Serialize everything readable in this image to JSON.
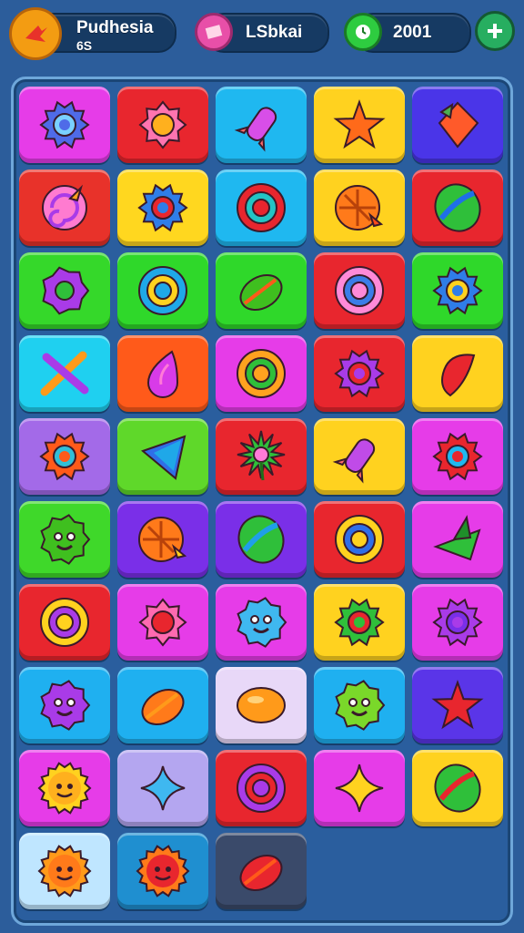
{
  "hud": {
    "player": {
      "name": "Pudhesia",
      "sub": "6S",
      "badge_color": "#f39c12"
    },
    "currency": {
      "label": "LSbkai",
      "icon_color": "#e84fa8"
    },
    "score": {
      "value": "2001",
      "icon_color": "#2ecc40"
    },
    "add_button": {
      "icon": "plus-icon",
      "color": "#27ae60"
    }
  },
  "board": {
    "rows": [
      [
        {
          "bg": "#e63ce8",
          "icon": "gear",
          "c1": "#4f6be8",
          "c2": "#7ad0ff"
        },
        {
          "bg": "#e8262e",
          "icon": "flower",
          "c1": "#ff74b0",
          "c2": "#ffb01e"
        },
        {
          "bg": "#1fb8f0",
          "icon": "rocket",
          "c1": "#d84ee8",
          "c2": "#ff6b6b"
        },
        {
          "bg": "#ffd21f",
          "icon": "star",
          "c1": "#ff6a1a",
          "c2": "#2e7d32"
        },
        {
          "bg": "#4a35e8",
          "icon": "kite",
          "c1": "#ff5a2a",
          "c2": "#4caf50"
        }
      ],
      [
        {
          "bg": "#e8322a",
          "icon": "swirl",
          "c1": "#ff7bd0",
          "c2": "#ffa21f"
        },
        {
          "bg": "#ffd71f",
          "icon": "gear",
          "c1": "#2f7de8",
          "c2": "#e8262e"
        },
        {
          "bg": "#1fb8f0",
          "icon": "ring",
          "c1": "#e8262e",
          "c2": "#23c4c4"
        },
        {
          "bg": "#ffd21f",
          "icon": "shell",
          "c1": "#ff7a1a",
          "c2": "#ff4a1a"
        },
        {
          "bg": "#e8262e",
          "icon": "ball",
          "c1": "#2fbf3a",
          "c2": "#1f6fe8"
        }
      ],
      [
        {
          "bg": "#35d82a",
          "icon": "blob",
          "c1": "#a93be8",
          "c2": "#2fbf3a"
        },
        {
          "bg": "#2fd82a",
          "icon": "ring",
          "c1": "#1fa8e8",
          "c2": "#ffd21f"
        },
        {
          "bg": "#2fd82a",
          "icon": "leaf",
          "c1": "#3fbf1f",
          "c2": "#ff5a1a"
        },
        {
          "bg": "#e8262e",
          "icon": "ring",
          "c1": "#ff8ad8",
          "c2": "#3a7de8"
        },
        {
          "bg": "#2fd82a",
          "icon": "gear",
          "c1": "#2f7de8",
          "c2": "#ffd21f"
        }
      ],
      [
        {
          "bg": "#1fd0f0",
          "icon": "cross",
          "c1": "#ff9a1a",
          "c2": "#a93be8"
        },
        {
          "bg": "#ff5a1a",
          "icon": "drop",
          "c1": "#d83be8",
          "c2": "#ff7ad8"
        },
        {
          "bg": "#e63ce8",
          "icon": "ring",
          "c1": "#ffa21f",
          "c2": "#2fbf3a"
        },
        {
          "bg": "#e8262e",
          "icon": "gear",
          "c1": "#a93be8",
          "c2": "#e8262e"
        },
        {
          "bg": "#ffd21f",
          "icon": "heart",
          "c1": "#e8262e",
          "c2": "#ff5a5a"
        }
      ],
      [
        {
          "bg": "#a36ae8",
          "icon": "gear",
          "c1": "#ff5a1a",
          "c2": "#2fbfd8"
        },
        {
          "bg": "#5fd82a",
          "icon": "arrow",
          "c1": "#2f6fe8",
          "c2": "#1fa8e8"
        },
        {
          "bg": "#e8262e",
          "icon": "splat",
          "c1": "#2fbf3a",
          "c2": "#ff7ad8"
        },
        {
          "bg": "#ffd21f",
          "icon": "rocket",
          "c1": "#c04be8",
          "c2": "#ff6b6b"
        },
        {
          "bg": "#e63ce8",
          "icon": "gear",
          "c1": "#e8262e",
          "c2": "#1fb8f0"
        }
      ],
      [
        {
          "bg": "#3fd82a",
          "icon": "face",
          "c1": "#3fbf1f",
          "c2": "#1f6f1a"
        },
        {
          "bg": "#7a2fe8",
          "icon": "shell",
          "c1": "#ff7a1a",
          "c2": "#ffd21f"
        },
        {
          "bg": "#7a2fe8",
          "icon": "ball",
          "c1": "#2fbf3a",
          "c2": "#1f9fe8"
        },
        {
          "bg": "#e8262e",
          "icon": "ring",
          "c1": "#ffd21f",
          "c2": "#2f6fe8"
        },
        {
          "bg": "#e63ce8",
          "icon": "hat",
          "c1": "#2fbf3a",
          "c2": "#1f8f2a"
        }
      ],
      [
        {
          "bg": "#e8262e",
          "icon": "ring",
          "c1": "#ffd21f",
          "c2": "#a93be8"
        },
        {
          "bg": "#e63ce8",
          "icon": "flower",
          "c1": "#ff6ab0",
          "c2": "#e8262e"
        },
        {
          "bg": "#e63ce8",
          "icon": "face",
          "c1": "#3fb8f0",
          "c2": "#1f6fe8"
        },
        {
          "bg": "#ffd21f",
          "icon": "gear",
          "c1": "#2fbf3a",
          "c2": "#e8262e"
        },
        {
          "bg": "#e63ce8",
          "icon": "gear",
          "c1": "#a93be8",
          "c2": "#7a2fe8"
        }
      ],
      [
        {
          "bg": "#1fb0f0",
          "icon": "face",
          "c1": "#a93be8",
          "c2": "#2fbf3a"
        },
        {
          "bg": "#1fb0f0",
          "icon": "leaf",
          "c1": "#ff7a1a",
          "c2": "#ff9a1a"
        },
        {
          "bg": "#e8d8f8",
          "icon": "oval",
          "c1": "#ff9a1a",
          "c2": "#ffb01e"
        },
        {
          "bg": "#1fb0f0",
          "icon": "face",
          "c1": "#7ad82a",
          "c2": "#2fbf3a"
        },
        {
          "bg": "#5a35e8",
          "icon": "star",
          "c1": "#e8262e",
          "c2": "#2fb8f0"
        }
      ],
      [
        {
          "bg": "#e63ce8",
          "icon": "sun",
          "c1": "#ffd21f",
          "c2": "#ffb01e"
        },
        {
          "bg": "#b4a6f0",
          "icon": "plus",
          "c1": "#3fb8f0",
          "c2": "#1f8fe8"
        },
        {
          "bg": "#e8262e",
          "icon": "ring",
          "c1": "#a93be8",
          "c2": "#e8262e"
        },
        {
          "bg": "#e63ce8",
          "icon": "sparkle",
          "c1": "#ffd21f",
          "c2": "#ff9a1a"
        },
        {
          "bg": "#ffd21f",
          "icon": "ball",
          "c1": "#2fbf3a",
          "c2": "#e8262e"
        }
      ],
      [
        {
          "bg": "#bfe6ff",
          "icon": "sun",
          "c1": "#ff9a1a",
          "c2": "#ff7a1a"
        },
        {
          "bg": "#1f8fd0",
          "icon": "sun",
          "c1": "#ff7a1a",
          "c2": "#e8262e"
        },
        {
          "bg": "#3a4a6a",
          "icon": "leaf",
          "c1": "#e8262e",
          "c2": "#ff5a1a"
        }
      ]
    ]
  }
}
